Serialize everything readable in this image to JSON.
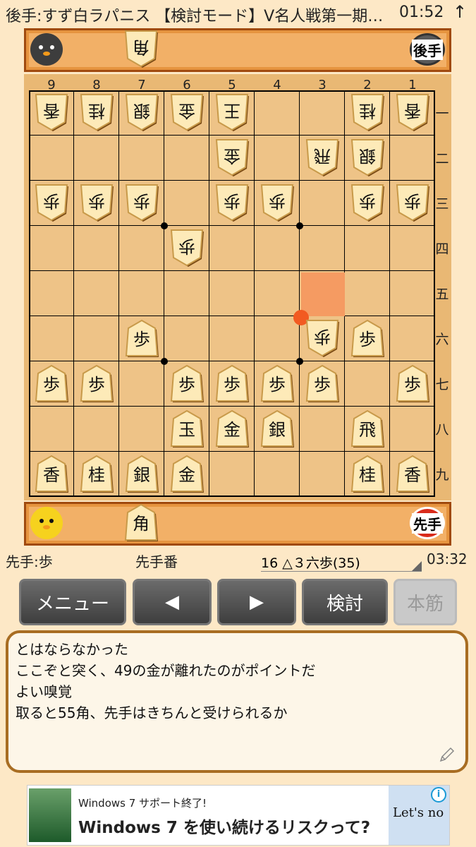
{
  "status_bar": {
    "title": "後手:すず白ラパニス 【検討モード】V名人戦第一期…",
    "time": "01:52",
    "arrow": "↑"
  },
  "gote": {
    "badge": "後手",
    "hand": [
      "角"
    ]
  },
  "sente": {
    "badge": "先手",
    "hand": [
      "角"
    ]
  },
  "board": {
    "columns": [
      "9",
      "8",
      "7",
      "6",
      "5",
      "4",
      "3",
      "2",
      "1"
    ],
    "rows": [
      "一",
      "二",
      "三",
      "四",
      "五",
      "六",
      "七",
      "八",
      "九"
    ],
    "pieces": [
      {
        "ch": "香",
        "owner": "gote",
        "file": 9,
        "rank": 1
      },
      {
        "ch": "桂",
        "owner": "gote",
        "file": 8,
        "rank": 1
      },
      {
        "ch": "銀",
        "owner": "gote",
        "file": 7,
        "rank": 1
      },
      {
        "ch": "金",
        "owner": "gote",
        "file": 6,
        "rank": 1
      },
      {
        "ch": "王",
        "owner": "gote",
        "file": 5,
        "rank": 1
      },
      {
        "ch": "桂",
        "owner": "gote",
        "file": 2,
        "rank": 1
      },
      {
        "ch": "香",
        "owner": "gote",
        "file": 1,
        "rank": 1
      },
      {
        "ch": "金",
        "owner": "gote",
        "file": 5,
        "rank": 2
      },
      {
        "ch": "飛",
        "owner": "gote",
        "file": 3,
        "rank": 2
      },
      {
        "ch": "銀",
        "owner": "gote",
        "file": 2,
        "rank": 2
      },
      {
        "ch": "歩",
        "owner": "gote",
        "file": 9,
        "rank": 3
      },
      {
        "ch": "歩",
        "owner": "gote",
        "file": 8,
        "rank": 3
      },
      {
        "ch": "歩",
        "owner": "gote",
        "file": 7,
        "rank": 3
      },
      {
        "ch": "歩",
        "owner": "gote",
        "file": 5,
        "rank": 3
      },
      {
        "ch": "歩",
        "owner": "gote",
        "file": 4,
        "rank": 3
      },
      {
        "ch": "歩",
        "owner": "gote",
        "file": 2,
        "rank": 3
      },
      {
        "ch": "歩",
        "owner": "gote",
        "file": 1,
        "rank": 3
      },
      {
        "ch": "歩",
        "owner": "gote",
        "file": 6,
        "rank": 4
      },
      {
        "ch": "歩",
        "owner": "gote",
        "file": 3,
        "rank": 6
      },
      {
        "ch": "歩",
        "owner": "sente",
        "file": 7,
        "rank": 6
      },
      {
        "ch": "歩",
        "owner": "sente",
        "file": 2,
        "rank": 6
      },
      {
        "ch": "歩",
        "owner": "sente",
        "file": 9,
        "rank": 7
      },
      {
        "ch": "歩",
        "owner": "sente",
        "file": 8,
        "rank": 7
      },
      {
        "ch": "歩",
        "owner": "sente",
        "file": 6,
        "rank": 7
      },
      {
        "ch": "歩",
        "owner": "sente",
        "file": 5,
        "rank": 7
      },
      {
        "ch": "歩",
        "owner": "sente",
        "file": 4,
        "rank": 7
      },
      {
        "ch": "歩",
        "owner": "sente",
        "file": 3,
        "rank": 7
      },
      {
        "ch": "歩",
        "owner": "sente",
        "file": 1,
        "rank": 7
      },
      {
        "ch": "玉",
        "owner": "sente",
        "file": 6,
        "rank": 8
      },
      {
        "ch": "金",
        "owner": "sente",
        "file": 5,
        "rank": 8
      },
      {
        "ch": "銀",
        "owner": "sente",
        "file": 4,
        "rank": 8
      },
      {
        "ch": "飛",
        "owner": "sente",
        "file": 2,
        "rank": 8
      },
      {
        "ch": "香",
        "owner": "sente",
        "file": 9,
        "rank": 9
      },
      {
        "ch": "桂",
        "owner": "sente",
        "file": 8,
        "rank": 9
      },
      {
        "ch": "銀",
        "owner": "sente",
        "file": 7,
        "rank": 9
      },
      {
        "ch": "金",
        "owner": "sente",
        "file": 6,
        "rank": 9
      },
      {
        "ch": "桂",
        "owner": "sente",
        "file": 2,
        "rank": 9
      },
      {
        "ch": "香",
        "owner": "sente",
        "file": 1,
        "rank": 9
      }
    ],
    "highlight": {
      "file": 3,
      "rank": 5
    },
    "colors": {
      "board": "#eec387",
      "frame": "#e9b874",
      "highlight": "#f59b62",
      "cursor": "#f25a21",
      "hand_bg": "#f2b067"
    }
  },
  "info": {
    "captured": "先手:歩",
    "turn": "先手番",
    "move": "16 △３六歩(35)",
    "clock": "03:32"
  },
  "buttons": {
    "menu": "メニュー",
    "back": "◀",
    "forward": "▶",
    "analyze": "検討",
    "mainline": "本筋"
  },
  "comment": {
    "lines": [
      "とはならなかった",
      "ここぞと突く、49の金が離れたのがポイントだ",
      "よい嗅覚",
      "取ると55角、先手はきちんと受けられるか"
    ]
  },
  "ad": {
    "small": "Windows 7 サポート終了!",
    "big": "Windows 7 を使い続けるリスクって?",
    "logo": "Let's no",
    "info": "i"
  }
}
